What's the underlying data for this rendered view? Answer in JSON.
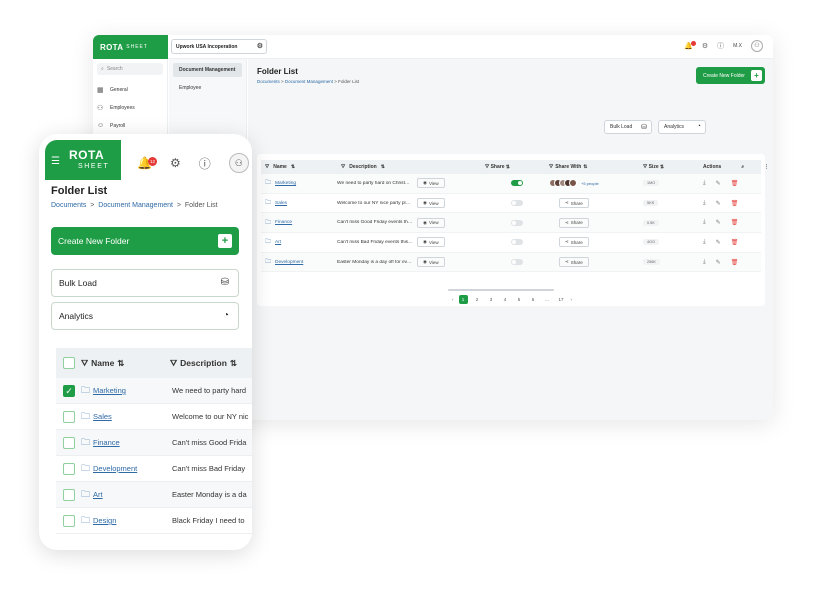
{
  "brand": {
    "name": "ROTA",
    "sub": "SHEET",
    "accent": "#1f9d46"
  },
  "desktop": {
    "company": "Upwork USA Incoperation",
    "user_initials": "M.X",
    "search_placeholder": "Search",
    "nav": [
      {
        "label": "General",
        "icon": "grid-icon"
      },
      {
        "label": "Employees",
        "icon": "users-icon"
      },
      {
        "label": "Payroll",
        "icon": "payroll-icon"
      }
    ],
    "subnav": [
      "Document Management",
      "Employee"
    ],
    "page_title": "Folder List",
    "breadcrumb": [
      "Documents",
      "Document Management",
      "Folder List"
    ],
    "create_label": "Create New Folder",
    "bulk_label": "Bulk Load",
    "analytics_label": "Analytics",
    "columns": [
      "Name",
      "Description",
      "Share",
      "Share With",
      "Size",
      "Actions"
    ],
    "rows": [
      {
        "name": "Marketing",
        "desc": "We need to party hard on Christmas",
        "share": true,
        "with": "people",
        "size": "1MO"
      },
      {
        "name": "Sales",
        "desc": "Welcome to our NY nice party place",
        "share": false,
        "with": "share",
        "size": "5KS"
      },
      {
        "name": "Finance",
        "desc": "Can't miss Good Friday events this year",
        "share": false,
        "with": "share",
        "size": "0.5K"
      },
      {
        "name": "Art",
        "desc": "Can't miss Bad Friday events this year",
        "share": false,
        "with": "share",
        "size": "4GO"
      },
      {
        "name": "Development",
        "desc": "Easter Monday is a day off for everyone",
        "share": false,
        "with": "share",
        "size": "256K"
      }
    ],
    "view_label": "View",
    "share_label": "Share",
    "people_count": "+5 people",
    "pages": [
      "1",
      "2",
      "3",
      "4",
      "5",
      "6",
      "...",
      "17"
    ]
  },
  "mobile": {
    "notif_count": "12",
    "page_title": "Folder List",
    "breadcrumb": [
      "Documents",
      "Document Management",
      "Folder List"
    ],
    "create_label": "Create New Folder",
    "bulk_label": "Bulk Load",
    "analytics_label": "Analytics",
    "columns": [
      "Name",
      "Description"
    ],
    "rows": [
      {
        "name": "Marketing",
        "desc": "We need to party hard",
        "checked": true
      },
      {
        "name": "Sales",
        "desc": "Welcome to our NY nic",
        "checked": false
      },
      {
        "name": "Finance",
        "desc": "Can't miss Good Frida",
        "checked": false
      },
      {
        "name": "Development",
        "desc": "Can't miss Bad Friday",
        "checked": false
      },
      {
        "name": "Art",
        "desc": "Easter Monday is a da",
        "checked": false
      },
      {
        "name": "Design",
        "desc": "Black Friday I need to",
        "checked": false
      }
    ]
  }
}
